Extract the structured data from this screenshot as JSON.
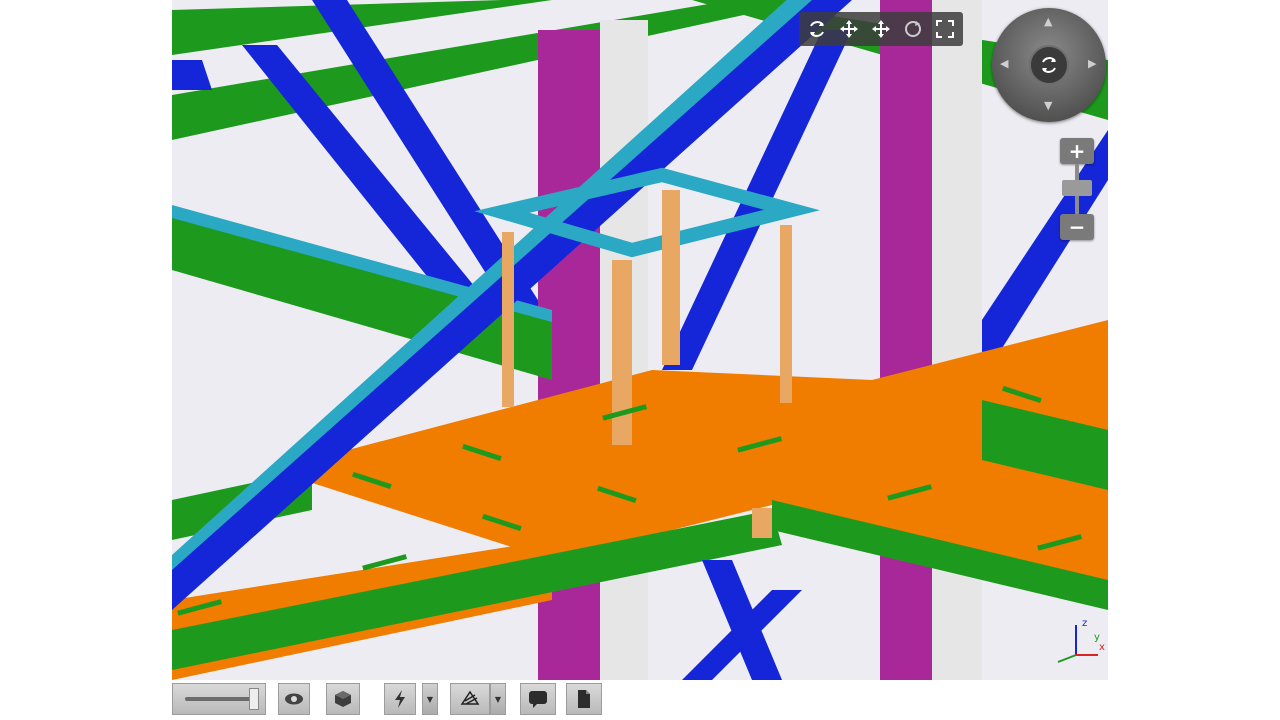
{
  "app": {
    "view_name": "3D structural model viewer"
  },
  "navigation_toolbar": {
    "buttons": [
      {
        "icon": "orbit-icon"
      },
      {
        "icon": "pan-icon"
      },
      {
        "icon": "move-icon"
      },
      {
        "icon": "rotate-icon"
      },
      {
        "icon": "fullscreen-icon"
      }
    ]
  },
  "view_controls": {
    "wheel_center_icon": "orbit-icon",
    "zoom_in_label": "+",
    "zoom_out_label": "−"
  },
  "axis_triad": {
    "x_label": "x",
    "y_label": "y",
    "z_label": "z"
  },
  "bottom_toolbar": {
    "opacity_slider_value": 1.0,
    "buttons": [
      {
        "icon": "eye-icon"
      },
      {
        "icon": "cube-icon"
      },
      {
        "icon": "lightning-icon",
        "has_dropdown": true
      },
      {
        "icon": "section-icon",
        "has_dropdown": true
      },
      {
        "icon": "comment-icon"
      },
      {
        "icon": "document-icon"
      }
    ]
  },
  "colors": {
    "beam_green": "#1d9a1d",
    "brace_blue": "#1526d9",
    "slab_orange": "#f07c00",
    "column_magenta": "#a8289a",
    "column_white": "#e6e6e6",
    "frame_teal": "#2aa8c4",
    "post_tan": "#e8a864",
    "ui_dark": "#3c3c3c"
  }
}
